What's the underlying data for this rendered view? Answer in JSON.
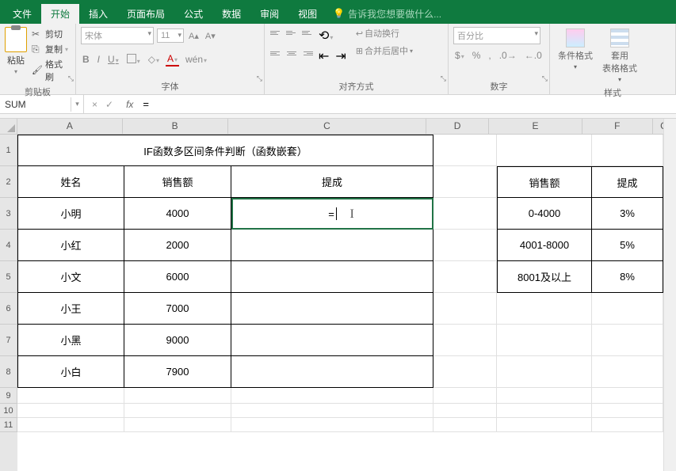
{
  "tabs": {
    "file": "文件",
    "home": "开始",
    "insert": "插入",
    "layout": "页面布局",
    "formula": "公式",
    "data": "数据",
    "review": "审阅",
    "view": "视图",
    "tellme": "告诉我您想要做什么..."
  },
  "ribbon": {
    "clipboard": {
      "label": "剪贴板",
      "paste": "粘贴",
      "cut": "剪切",
      "copy": "复制",
      "brush": "格式刷"
    },
    "font": {
      "label": "字体",
      "name": "宋体",
      "size": "11",
      "bold": "B",
      "italic": "I",
      "underline": "U",
      "wen": "wén"
    },
    "align": {
      "label": "对齐方式",
      "wrap": "自动换行",
      "merge": "合并后居中"
    },
    "number": {
      "label": "数字",
      "format": "百分比"
    },
    "styles": {
      "label": "样式",
      "cond": "条件格式",
      "table": "套用\n表格格式"
    }
  },
  "namebox": "SUM",
  "fb": {
    "cancel": "×",
    "confirm": "✓"
  },
  "formula": "=",
  "cols": {
    "A": 135,
    "B": 135,
    "C": 255,
    "D": 80,
    "E": 120,
    "F": 90,
    "G": 30
  },
  "rowH": {
    "title": 40,
    "hdr": 40,
    "data": 40,
    "small": 20
  },
  "sheet": {
    "title": "IF函数多区间条件判断（函数嵌套）",
    "hdrA": "姓名",
    "hdrB": "销售额",
    "hdrC": "提成",
    "hdrE": "销售额",
    "hdrF": "提成",
    "r": [
      {
        "a": "小明",
        "b": "4000",
        "c": "=",
        "e": "0-4000",
        "f": "3%"
      },
      {
        "a": "小红",
        "b": "2000",
        "c": "",
        "e": "4001-8000",
        "f": "5%"
      },
      {
        "a": "小文",
        "b": "6000",
        "c": "",
        "e": "8001及以上",
        "f": "8%"
      },
      {
        "a": "小王",
        "b": "7000",
        "c": "",
        "e": "",
        "f": ""
      },
      {
        "a": "小黑",
        "b": "9000",
        "c": "",
        "e": "",
        "f": ""
      },
      {
        "a": "小白",
        "b": "7900",
        "c": "",
        "e": "",
        "f": ""
      }
    ]
  }
}
